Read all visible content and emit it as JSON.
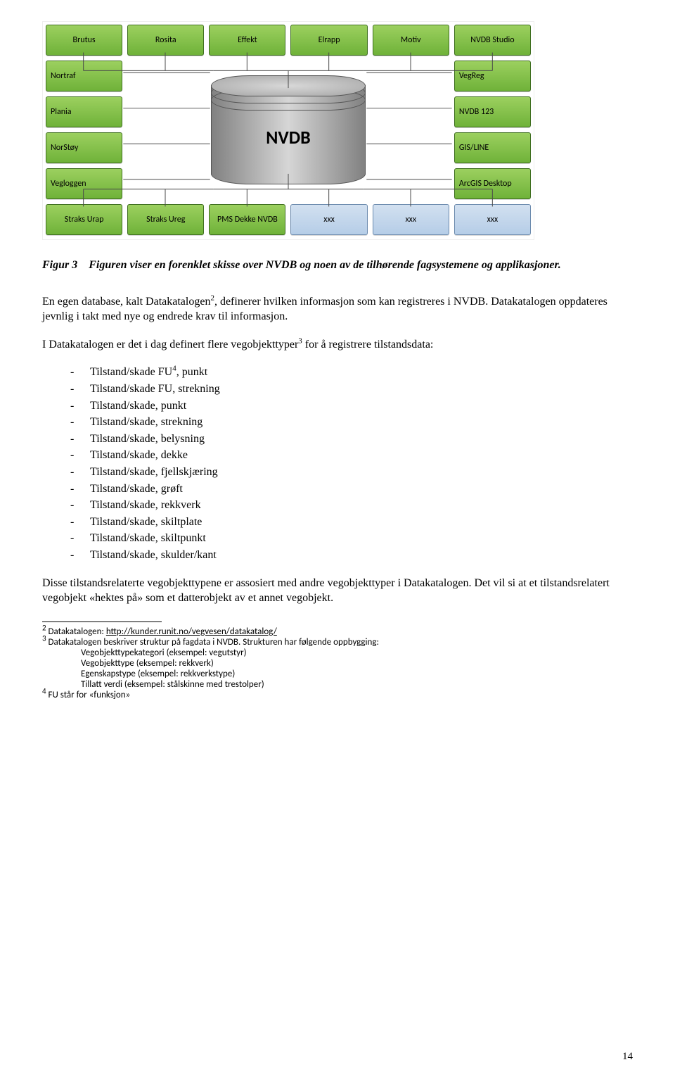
{
  "diagram": {
    "top_row": [
      "Brutus",
      "Rosita",
      "Effekt",
      "Elrapp",
      "Motiv",
      "NVDB Studio"
    ],
    "left_col": [
      "Nortraf",
      "Plania",
      "NorStøy",
      "Vegloggen"
    ],
    "right_col": [
      "VegReg",
      "NVDB 123",
      "GIS/LINE",
      "ArcGIS Desktop"
    ],
    "bottom_row": [
      "Straks Urap",
      "Straks Ureg",
      "PMS Dekke NVDB",
      "xxx",
      "xxx",
      "xxx"
    ],
    "cylinder_label": "NVDB"
  },
  "caption": {
    "lead": "Figur 3",
    "rest": "Figuren viser en forenklet skisse over NVDB og noen av de tilhørende fagsystemene og applikasjoner."
  },
  "p1_a": "En egen database, kalt Datakatalogen",
  "p1_b": ", definerer hvilken informasjon som kan registreres i NVDB. Datakatalogen oppdateres jevnlig i takt med nye og endrede krav til informasjon.",
  "p2_a": "I Datakatalogen er det i dag definert flere vegobjekttyper",
  "p2_b": " for å registrere tilstandsdata:",
  "sup2": "2",
  "sup3": "3",
  "sup4": "4",
  "list": [
    {
      "a": "Tilstand/skade FU",
      "b": ", punkt",
      "sup": "4"
    },
    {
      "a": "Tilstand/skade FU, strekning",
      "b": "",
      "sup": ""
    },
    {
      "a": "Tilstand/skade, punkt",
      "b": "",
      "sup": ""
    },
    {
      "a": "Tilstand/skade, strekning",
      "b": "",
      "sup": ""
    },
    {
      "a": "Tilstand/skade, belysning",
      "b": "",
      "sup": ""
    },
    {
      "a": "Tilstand/skade, dekke",
      "b": "",
      "sup": ""
    },
    {
      "a": "Tilstand/skade, fjellskjæring",
      "b": "",
      "sup": ""
    },
    {
      "a": "Tilstand/skade, grøft",
      "b": "",
      "sup": ""
    },
    {
      "a": "Tilstand/skade, rekkverk",
      "b": "",
      "sup": ""
    },
    {
      "a": "Tilstand/skade, skiltplate",
      "b": "",
      "sup": ""
    },
    {
      "a": "Tilstand/skade, skiltpunkt",
      "b": "",
      "sup": ""
    },
    {
      "a": "Tilstand/skade, skulder/kant",
      "b": "",
      "sup": ""
    }
  ],
  "p3": "Disse tilstandsrelaterte vegobjekttypene er assosiert med andre vegobjekttyper i Datakatalogen. Det vil si at et tilstandsrelatert vegobjekt «hektes på» som et datterobjekt av et annet vegobjekt.",
  "footnotes": {
    "fn2_a": "Datakatalogen: ",
    "fn2_link": "http://kunder.runit.no/vegvesen/datakatalog/",
    "fn3_a": "Datakatalogen beskriver struktur på fagdata i NVDB. Strukturen har følgende oppbygging:",
    "fn3_lines": [
      "Vegobjekttypekategori (eksempel: vegutstyr)",
      "Vegobjekttype (eksempel: rekkverk)",
      "Egenskapstype (eksempel: rekkverkstype)",
      "Tillatt verdi (eksempel: stålskinne med trestolper)"
    ],
    "fn4": "FU står for «funksjon»"
  },
  "page_number": "14"
}
